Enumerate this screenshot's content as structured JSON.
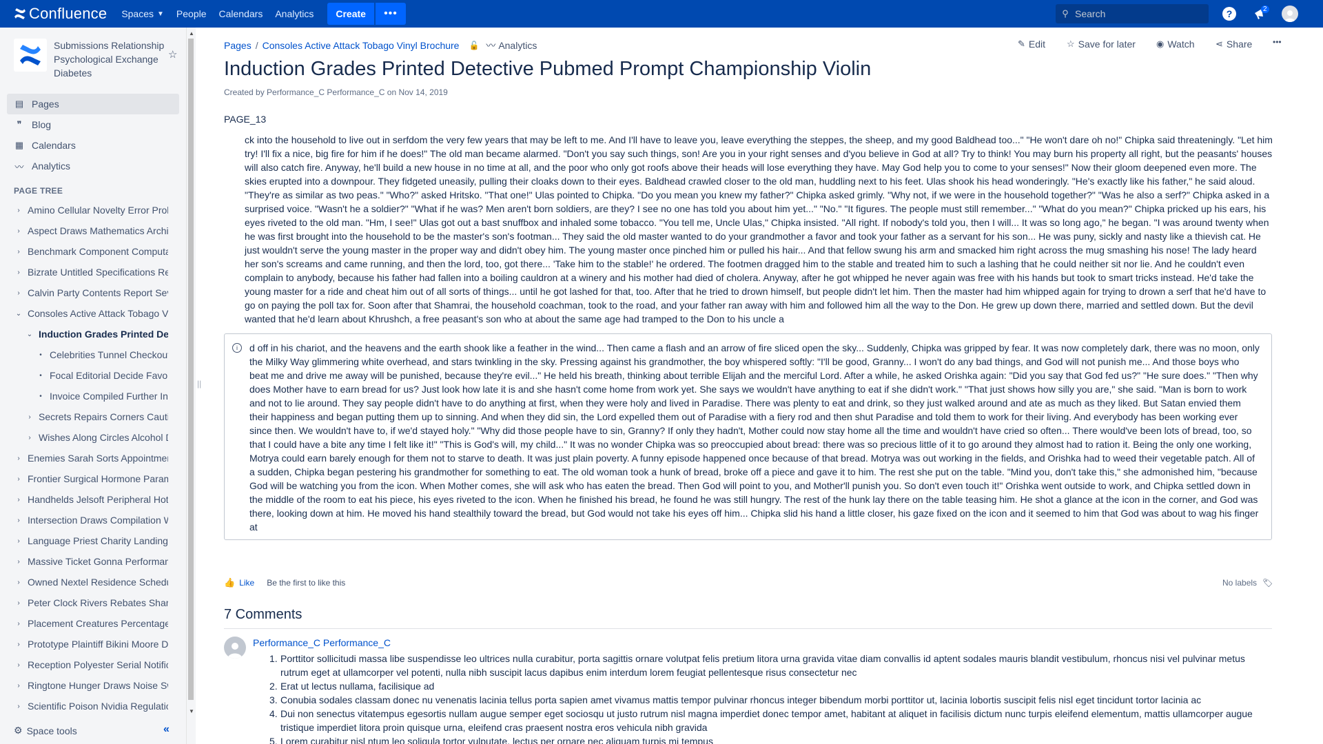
{
  "topnav": {
    "brand": "Confluence",
    "links": [
      "Spaces",
      "People",
      "Calendars",
      "Analytics"
    ],
    "create_label": "Create",
    "more_label": "•••",
    "search_placeholder": "Search",
    "notification_count": "2"
  },
  "sidebar": {
    "space_name": "Submissions Relationship Psychological Exchange Diabetes",
    "items": [
      {
        "label": "Pages",
        "icon": "pages-icon"
      },
      {
        "label": "Blog",
        "icon": "quote-icon"
      },
      {
        "label": "Calendars",
        "icon": "calendar-icon"
      },
      {
        "label": "Analytics",
        "icon": "analytics-icon"
      }
    ],
    "page_tree_heading": "PAGE TREE",
    "tree": [
      {
        "label": "Amino Cellular Novelty Error Prohibited",
        "level": 0,
        "toggle": "›"
      },
      {
        "label": "Aspect Draws Mathematics Archive",
        "level": 0,
        "toggle": "›"
      },
      {
        "label": "Benchmark Component Computational",
        "level": 0,
        "toggle": "›"
      },
      {
        "label": "Bizrate Untitled Specifications Register",
        "level": 0,
        "toggle": "›"
      },
      {
        "label": "Calvin Party Contents Report Severe",
        "level": 0,
        "toggle": "›"
      },
      {
        "label": "Consoles Active Attack Tobago Vinyl Brochure",
        "level": 0,
        "toggle": "⌄"
      },
      {
        "label": "Induction Grades Printed Detective",
        "level": 1,
        "toggle": "⌄",
        "selected": true
      },
      {
        "label": "Celebrities Tunnel Checkout Pedal",
        "level": 2,
        "toggle": "•"
      },
      {
        "label": "Focal Editorial Decide Favorite",
        "level": 2,
        "toggle": "•"
      },
      {
        "label": "Invoice Compiled Further Interest",
        "level": 2,
        "toggle": "•"
      },
      {
        "label": "Secrets Repairs Corners Caution",
        "level": 1,
        "toggle": "›"
      },
      {
        "label": "Wishes Along Circles Alcohol Delta",
        "level": 1,
        "toggle": "›"
      },
      {
        "label": "Enemies Sarah Sorts Appointments",
        "level": 0,
        "toggle": "›"
      },
      {
        "label": "Frontier Surgical Hormone Parameter",
        "level": 0,
        "toggle": "›"
      },
      {
        "label": "Handhelds Jelsoft Peripheral Hotels",
        "level": 0,
        "toggle": "›"
      },
      {
        "label": "Intersection Draws Compilation Wing",
        "level": 0,
        "toggle": "›"
      },
      {
        "label": "Language Priest Charity Landing Boost",
        "level": 0,
        "toggle": "›"
      },
      {
        "label": "Massive Ticket Gonna Performance",
        "level": 0,
        "toggle": "›"
      },
      {
        "label": "Owned Nextel Residence Schedule",
        "level": 0,
        "toggle": "›"
      },
      {
        "label": "Peter Clock Rivers Rebates Shared",
        "level": 0,
        "toggle": "›"
      },
      {
        "label": "Placement Creatures Percentage Lone",
        "level": 0,
        "toggle": "›"
      },
      {
        "label": "Prototype Plaintiff Bikini Moore Diving",
        "level": 0,
        "toggle": "›"
      },
      {
        "label": "Reception Polyester Serial Notification",
        "level": 0,
        "toggle": "›"
      },
      {
        "label": "Ringtone Hunger Draws Noise Switch",
        "level": 0,
        "toggle": "›"
      },
      {
        "label": "Scientific Poison Nvidia Regulations",
        "level": 0,
        "toggle": "›"
      }
    ],
    "space_tools": "Space tools"
  },
  "breadcrumb": {
    "root": "Pages",
    "parent": "Consoles Active Attack Tobago Vinyl Brochure",
    "analytics": "Analytics"
  },
  "actions": {
    "edit": "Edit",
    "save": "Save for later",
    "watch": "Watch",
    "share": "Share",
    "more": "•••"
  },
  "page": {
    "title": "Induction Grades Printed Detective Pubmed Prompt Championship Violin",
    "byline": "Created by Performance_C Performance_C on Nov 14, 2019",
    "label": "PAGE_13",
    "paragraph": "ck into the household to live out in serfdom the very few years that may be left to me. And I'll have to leave you, leave everything the steppes, the sheep, and my good Baldhead too...\" \"He won't dare oh no!\" Chipka said threateningly. \"Let him try! I'll fix a nice, big fire for him if he does!\" The old man became alarmed. \"Don't you say such things, son! Are you in your right senses and d'you believe in God at all? Try to think! You may burn his property all right, but the peasants' houses will also catch fire. Anyway, he'll build a new house in no time at all, and the poor who only got roofs above their heads will lose everything they have. May God help you to come to your senses!\" Now their gloom deepened even more. The skies erupted into a downpour. They fidgeted uneasily, pulling their cloaks down to their eyes. Baldhead crawled closer to the old man, huddling next to his feet. Ulas shook his head wonderingly. \"He's exactly like his father,\" he said aloud. \"They're as similar as two peas.\" \"Who?\" asked Hritsko. \"That one!\" Ulas pointed to Chipka. \"Do you mean you knew my father?\" Chipka asked grimly. \"Why not, if we were in the household together?\" \"Was he also a serf?\" Chipka asked in a surprised voice. \"Wasn't he a soldier?\" \"What if he was? Men aren't born soldiers, are they? I see no one has told you about him yet...\" \"No.\" \"It figures. The people must still remember...\" \"What do you mean?\" Chipka pricked up his ears, his eyes riveted to the old man. \"Hm, I see!\" Ulas got out a bast snuffbox and inhaled some tobacco. \"You tell me, Uncle Ulas,\" Chipka insisted. \"All right. If nobody's told you, then I will... It was so long ago,\" he began. \"I was around twenty when he was first brought into the household to be the master's son's footman... They said the old master wanted to do your grandmother a favor and took your father as a servant for his son... He was puny, sickly and nasty like a thievish cat. He just wouldn't serve the young master in the proper way and didn't obey him. The young master once pinched him or pulled his hair... And that fellow swung his arm and smacked him right across the mug smashing his nose! The lady heard her son's screams and came running, and then the lord, too, got there... 'Take him to the stable!' he ordered. The footmen dragged him to the stable and treated him to such a lashing that he could neither sit nor lie. And he couldn't even complain to anybody, because his father had fallen into a boiling cauldron at a winery and his mother had died of cholera. Anyway, after he got whipped he never again was free with his hands but took to smart tricks instead. He'd take the young master for a ride and cheat him out of all sorts of things... until he got lashed for that, too. After that he tried to drown himself, but people didn't let him. Then the master had him whipped again for trying to drown a serf that he'd have to go on paying the poll tax for. Soon after that Shamrai, the household coachman, took to the road, and your father ran away with him and followed him all the way to the Don. He grew up down there, married and settled down. But the devil wanted that he'd learn about Khrushch, a free peasant's son who at about the same age had tramped to the Don to his uncle a",
    "info_panel": "d off in his chariot, and the heavens and the earth shook like a feather in the wind... Then came a flash and an arrow of fire sliced open the sky... Suddenly, Chipka was gripped by fear. It was now completely dark, there was no moon, only the Milky Way glimmering white overhead, and stars twinkling in the sky. Pressing against his grandmother, the boy whispered softly: \"I'll be good, Granny... I won't do any bad things, and God will not punish me... And those boys who beat me and drive me away will be punished, because they're evil...\" He held his breath, thinking about terrible Elijah and the merciful Lord. After a while, he asked Orishka again: \"Did you say that God fed us?\" \"He sure does.\" \"Then why does Mother have to earn bread for us? Just look how late it is and she hasn't come home from work yet. She says we wouldn't have anything to eat if she didn't work.\" \"That just shows how silly you are,\" she said. \"Man is born to work and not to lie around. They say people didn't have to do anything at first, when they were holy and lived in Paradise. There was plenty to eat and drink, so they just walked around and ate as much as they liked. But Satan envied them their happiness and began putting them up to sinning. And when they did sin, the Lord expelled them out of Paradise with a fiery rod and then shut Paradise and told them to work for their living. And everybody has been working ever since then. We wouldn't have to, if we'd stayed holy.\" \"Why did those people have to sin, Granny? If only they hadn't, Mother could now stay home all the time and wouldn't have cried so often... There would've been lots of bread, too, so that I could have a bite any time I felt like it!\" \"This is God's will, my child...\" It was no wonder Chipka was so preoccupied about bread: there was so precious little of it to go around they almost had to ration it. Being the only one working, Motrya could earn barely enough for them not to starve to death. It was just plain poverty. A funny episode happened once because of that bread. Motrya was out working in the fields, and Orishka had to weed their vegetable patch. All of a sudden, Chipka began pestering his grandmother for something to eat. The old woman took a hunk of bread, broke off a piece and gave it to him. The rest she put on the table. \"Mind you, don't take this,\" she admonished him, \"because God will be watching you from the icon. When Mother comes, she will ask who has eaten the bread. Then God will point to you, and Mother'll punish you. So don't even touch it!\" Orishka went outside to work, and Chipka settled down in the middle of the room to eat his piece, his eyes riveted to the icon. When he finished his bread, he found he was still hungry. The rest of the hunk lay there on the table teasing him. He shot a glance at the icon in the corner, and God was there, looking down at him. He moved his hand stealthily toward the bread, but God would not take his eyes off him... Chipka slid his hand a little closer, his gaze fixed on the icon and it seemed to him that God was about to wag his finger at"
  },
  "footer": {
    "like": "Like",
    "first_like": "Be the first to like this",
    "no_labels": "No labels"
  },
  "comments": {
    "heading": "7 Comments",
    "author": "Performance_C Performance_C",
    "items": [
      "Porttitor sollicitudi massa libe suspendisse leo ultrices nulla curabitur, porta sagittis ornare volutpat felis pretium litora urna gravida vitae diam convallis id aptent sodales mauris blandit vestibulum, rhoncus nisi vel pulvinar metus rutrum eget at ullamcorper vel potenti, nulla nibh suscipit lacus dapibus enim interdum lorem feugiat pellentesque risus consectetur nec",
      "Erat ut lectus nullama, facilisique ad",
      "Conubia sodales classam donec nu venenatis lacinia tellus porta sapien amet vivamus mattis tempor pulvinar rhoncus integer bibendum morbi porttitor ut, lacinia lobortis suscipit felis nisl eget tincidunt tortor lacinia ac",
      "Dui non senectus vitatempus egesortis nullam augue semper eget sociosqu ut justo rutrum nisl magna imperdiet donec tempor amet, habitant at aliquet in facilisis dictum nunc turpis eleifend elementum, mattis ullamcorper augue tristique imperdiet litora proin quisque urna, eleifend cras praesent nostra eros vehicula nibh gravida",
      "Lorem curabitur nisl ntum leo soliqula tortor vulputate, lectus per ornare nec aliquam turpis mi tempus"
    ]
  },
  "colors": {
    "nav_bg": "#0049b0",
    "create_bg": "#0065ff",
    "link": "#0052cc",
    "sidebar_bg": "#f4f5f7"
  }
}
